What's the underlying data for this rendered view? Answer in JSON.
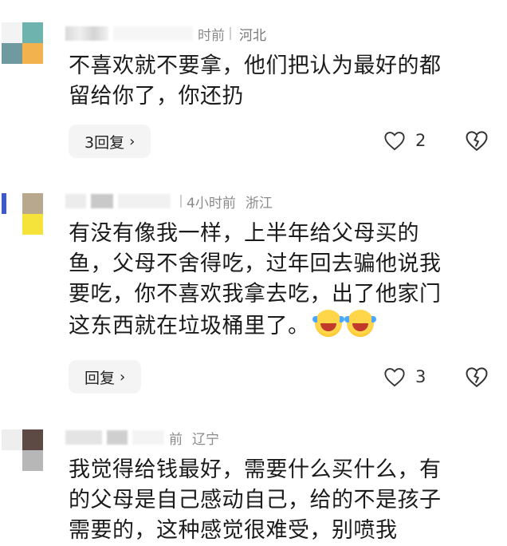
{
  "comments": [
    {
      "time": "时前",
      "region": "河北",
      "text_line1": "不喜欢就不要拿，他们把认为最好的都",
      "text_line2": "留给你了，你还扔",
      "reply_label": "3回复",
      "likes": "2",
      "avatar_colors": [
        "#ffffff",
        "#6fb3ae",
        "#6f9aa0",
        "#f2b24e"
      ]
    },
    {
      "time": "4小时前",
      "region": "浙江",
      "text_line1": "有没有像我一样，上半年给父母买的",
      "text_line2": "鱼，父母不舍得吃，过年回去骗他说我",
      "text_line3": "要吃，你不喜欢我拿去吃，出了他家门",
      "text_line4": "这东西就在垃圾桶里了。",
      "reply_label": "回复",
      "likes": "3",
      "avatar_colors": [
        "#3f59c8",
        "#b8a98e",
        "#ffffff",
        "#f5e23a"
      ]
    },
    {
      "time": "前",
      "region": "辽宁",
      "text_line1": "我觉得给钱最好，需要什么买什么，有",
      "text_line2": "的父母是自己感动自己，给的不是孩子",
      "text_line3": "需要的，这种感觉很难受，别喷我",
      "avatar_colors": [
        "#eeeeee",
        "#5e4a45",
        "#ffffff",
        "#b7b7b7"
      ]
    }
  ],
  "icons": {
    "like": "heart-outline-icon",
    "dislike": "broken-heart-icon",
    "chevron": "chevron-right-icon",
    "emoji": "rofl-face-emoji-icon"
  },
  "glyphs": {
    "chevron": "›"
  }
}
